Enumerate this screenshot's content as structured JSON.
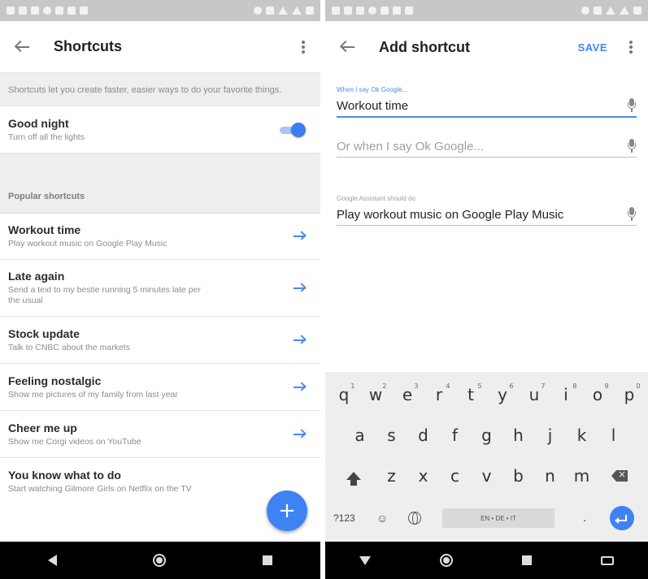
{
  "left_screen": {
    "appbar": {
      "title": "Shortcuts"
    },
    "intro": "Shortcuts let you create faster, easier ways to do your favorite things.",
    "custom_shortcut": {
      "title": "Good night",
      "subtitle": "Turn off all the lights",
      "enabled": true
    },
    "section_header": "Popular shortcuts",
    "popular": [
      {
        "title": "Workout time",
        "subtitle": "Play workout music on Google Play Music"
      },
      {
        "title": "Late again",
        "subtitle": "Send a text to my bestie running 5 minutes late per the usual"
      },
      {
        "title": "Stock update",
        "subtitle": "Talk to CNBC about the markets"
      },
      {
        "title": "Feeling nostalgic",
        "subtitle": "Show me pictures of my family from last year"
      },
      {
        "title": "Cheer me up",
        "subtitle": "Show me Corgi videos on YouTube"
      },
      {
        "title": "You know what to do",
        "subtitle": "Start watching Gilmore Girls on Netflix on the TV"
      }
    ],
    "fab_symbol": "+"
  },
  "right_screen": {
    "appbar": {
      "title": "Add shortcut",
      "save_label": "SAVE"
    },
    "field_primary": {
      "label": "When I say Ok Google...",
      "value": "Workout time"
    },
    "field_alt": {
      "placeholder": "Or when I say Ok Google..."
    },
    "field_action": {
      "label": "Google Assistant should do",
      "value": "Play workout music on Google Play Music"
    },
    "keyboard": {
      "row1": [
        {
          "key": "q",
          "hint": "1"
        },
        {
          "key": "w",
          "hint": "2"
        },
        {
          "key": "e",
          "hint": "3"
        },
        {
          "key": "r",
          "hint": "4"
        },
        {
          "key": "t",
          "hint": "5"
        },
        {
          "key": "y",
          "hint": "6"
        },
        {
          "key": "u",
          "hint": "7"
        },
        {
          "key": "i",
          "hint": "8"
        },
        {
          "key": "o",
          "hint": "9"
        },
        {
          "key": "p",
          "hint": "0"
        }
      ],
      "row2": [
        "a",
        "s",
        "d",
        "f",
        "g",
        "h",
        "j",
        "k",
        "l"
      ],
      "row3": [
        "z",
        "x",
        "c",
        "v",
        "b",
        "n",
        "m"
      ],
      "symbols_label": "?123",
      "emoji_label": "☺",
      "space_label": "EN • DE • IT",
      "period_label": "."
    }
  },
  "colors": {
    "accent": "#4285f4",
    "statusbar": "#c7c7c7",
    "navbar": "#000000",
    "section_bg": "#eeeeee"
  }
}
